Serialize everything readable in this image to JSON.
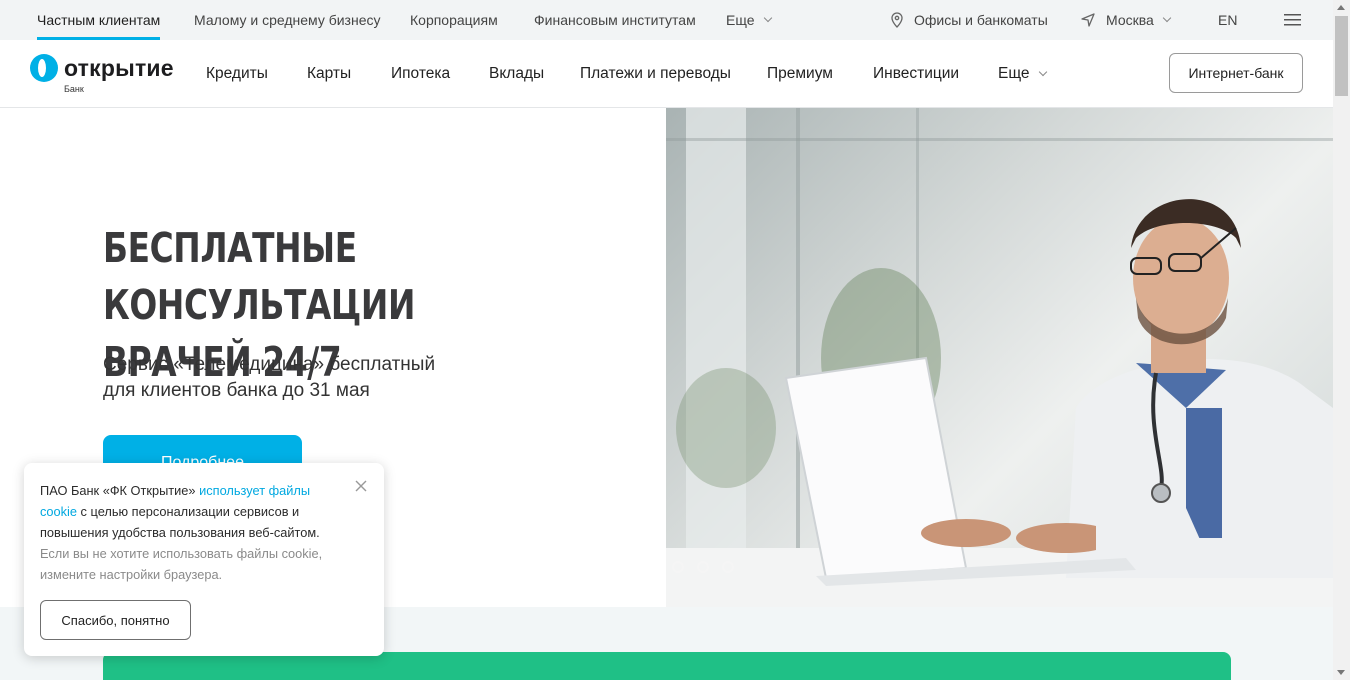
{
  "topbar": {
    "segments": [
      {
        "label": "Частным клиентам"
      },
      {
        "label": "Малому и среднему бизнесу"
      },
      {
        "label": "Корпорациям"
      },
      {
        "label": "Финансовым институтам"
      },
      {
        "label": "Еще"
      }
    ],
    "offices": "Офисы и банкоматы",
    "city": "Москва",
    "lang": "EN",
    "menu_icon": "hamburger-icon"
  },
  "header": {
    "logo_text": "открытие",
    "logo_sub": "Банк",
    "nav": [
      {
        "label": "Кредиты"
      },
      {
        "label": "Карты"
      },
      {
        "label": "Ипотека"
      },
      {
        "label": "Вклады"
      },
      {
        "label": "Платежи и переводы"
      },
      {
        "label": "Премиум"
      },
      {
        "label": "Инвестиции"
      },
      {
        "label": "Еще"
      }
    ],
    "internet_bank": "Интернет-банк"
  },
  "hero": {
    "title_line1": "БЕСПЛАТНЫЕ КОНСУЛЬТАЦИИ",
    "title_line2": "ВРАЧЕЙ 24/7",
    "subtitle_line1": "Сервис «Телемедицина» бесплатный",
    "subtitle_line2": "для клиентов банка до 31 мая",
    "button": "Подробнее"
  },
  "cookie": {
    "text_part1": "ПАО Банк «ФК Открытие» ",
    "link": "использует файлы cookie",
    "text_part2": " с целью персонализации сервисов и повышения удобства пользования веб-сайтом.",
    "muted": "Если вы не хотите использовать файлы cookie, измените настройки браузера.",
    "button": "Спасибо, понятно"
  },
  "colors": {
    "accent": "#00b0e6",
    "green": "#1fc086",
    "topbar_bg": "#f2f4f5"
  }
}
